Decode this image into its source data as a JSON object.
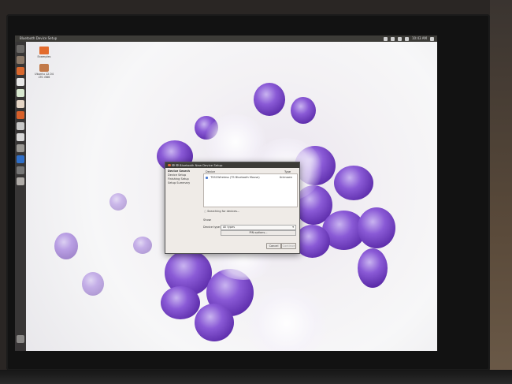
{
  "topbar": {
    "title": "Bluetooth Device Setup",
    "clock": "10:43 AM"
  },
  "desktop_icons": [
    {
      "label": "Examples"
    },
    {
      "label": "Ubuntu 12.04 LTS i386"
    }
  ],
  "dialog": {
    "title": "Bluetooth New Device Setup",
    "sidebar": [
      "Device Search",
      "Device Setup",
      "Finishing Setup",
      "Setup Summary"
    ],
    "list_header_device": "Device",
    "list_header_type": "Type",
    "devices": [
      {
        "name": "TSSCWireless (TS Bluetooth Mouse)",
        "type": "Unknown"
      }
    ],
    "searching_label": "Searching for devices...",
    "show_label": "Show:",
    "device_type_label": "Device type:",
    "device_type_value": "All types",
    "pin_button": "PIN options...",
    "cancel_button": "Cancel",
    "continue_button": "Continue"
  },
  "colors": {
    "accent": "#e0673a",
    "launcher": "#2a2828",
    "berry": "#7a45c8"
  }
}
